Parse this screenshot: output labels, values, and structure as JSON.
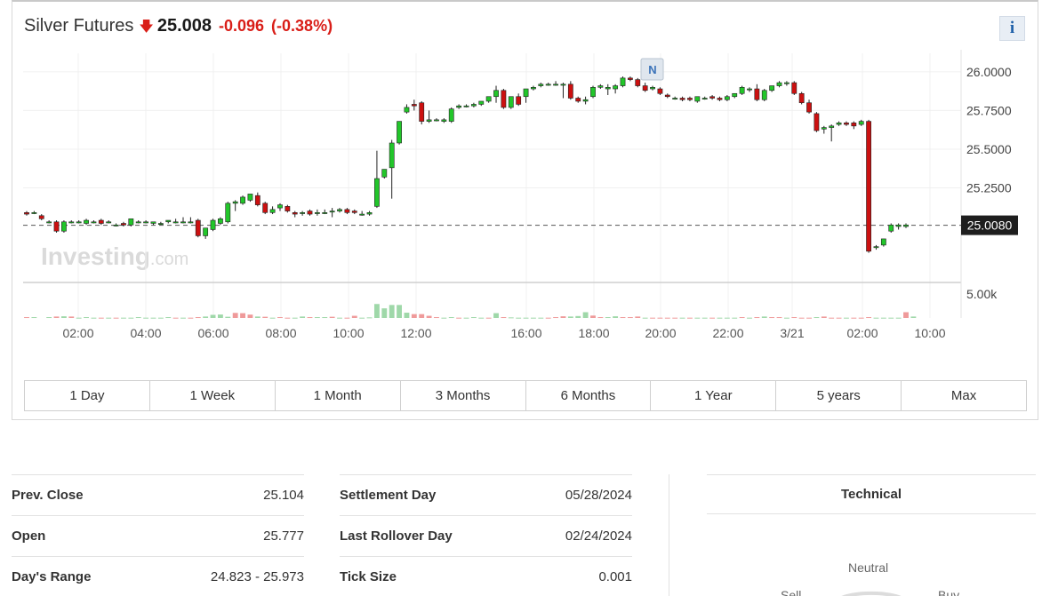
{
  "header": {
    "title": "Silver Futures",
    "direction_icon": "down-arrow-icon",
    "price": "25.008",
    "change": "-0.096",
    "change_pct": "(-0.38%)",
    "info_label": "i"
  },
  "colors": {
    "up": "#22c62a",
    "down": "#cc1010",
    "vol_up": "#9fd8a9",
    "vol_down": "#ef9a9a"
  },
  "chart_data": {
    "type": "candlestick",
    "y_ticks": [
      "26.0000",
      "25.7500",
      "25.5000",
      "25.2500"
    ],
    "ylim": [
      24.73,
      26.12
    ],
    "current_price_label": "25.0080",
    "current_price": 25.008,
    "volume_tick_label": "5.00k",
    "volume_tick_value": 5000,
    "volume_max": 7000,
    "x_ticks": [
      "02:00",
      "04:00",
      "06:00",
      "08:00",
      "10:00",
      "12:00",
      "16:00",
      "18:00",
      "20:00",
      "22:00",
      "3/21",
      "02:00",
      "10:00"
    ],
    "news_marker": "N",
    "watermark": "Investing",
    "watermark_suffix": ".com",
    "candles": [
      [
        25.09,
        25.1,
        25.08,
        25.07
      ],
      [
        25.09,
        25.1,
        25.09,
        25.08
      ],
      [
        25.07,
        25.08,
        25.05,
        25.04
      ],
      [
        25.03,
        25.04,
        25.03,
        25.02
      ],
      [
        25.03,
        25.04,
        24.97,
        24.96
      ],
      [
        24.97,
        25.04,
        25.03,
        24.96
      ],
      [
        25.03,
        25.04,
        25.03,
        25.02
      ],
      [
        25.03,
        25.04,
        25.03,
        25.02
      ],
      [
        25.02,
        25.05,
        25.04,
        25.01
      ],
      [
        25.03,
        25.04,
        25.03,
        25.02
      ],
      [
        25.04,
        25.05,
        25.02,
        25.01
      ],
      [
        25.03,
        25.04,
        25.03,
        25.02
      ],
      [
        25.01,
        25.02,
        25.01,
        25.0
      ],
      [
        25.02,
        25.03,
        25.01,
        25.0
      ],
      [
        25.01,
        25.05,
        25.05,
        25.0
      ],
      [
        25.03,
        25.04,
        25.03,
        25.02
      ],
      [
        25.03,
        25.04,
        25.03,
        25.02
      ],
      [
        25.02,
        25.03,
        25.03,
        25.01
      ],
      [
        25.02,
        25.03,
        25.02,
        25.01
      ],
      [
        25.03,
        25.04,
        25.04,
        25.02
      ],
      [
        25.03,
        25.05,
        25.03,
        25.02
      ],
      [
        25.03,
        25.06,
        25.03,
        25.02
      ],
      [
        25.03,
        25.06,
        25.03,
        25.02
      ],
      [
        25.04,
        25.05,
        24.94,
        24.93
      ],
      [
        24.94,
        24.99,
        24.99,
        24.92
      ],
      [
        24.98,
        25.05,
        25.04,
        24.97
      ],
      [
        25.02,
        25.06,
        25.05,
        25.01
      ],
      [
        25.03,
        25.16,
        25.15,
        25.02
      ],
      [
        25.15,
        25.17,
        25.16,
        25.1
      ],
      [
        25.15,
        25.2,
        25.19,
        25.14
      ],
      [
        25.17,
        25.21,
        25.21,
        25.16
      ],
      [
        25.2,
        25.22,
        25.14,
        25.13
      ],
      [
        25.15,
        25.16,
        25.09,
        25.08
      ],
      [
        25.09,
        25.13,
        25.11,
        25.08
      ],
      [
        25.12,
        25.15,
        25.14,
        25.1
      ],
      [
        25.13,
        25.14,
        25.1,
        25.09
      ],
      [
        25.09,
        25.1,
        25.08,
        25.06
      ],
      [
        25.09,
        25.1,
        25.09,
        25.07
      ],
      [
        25.1,
        25.11,
        25.08,
        25.07
      ],
      [
        25.09,
        25.11,
        25.09,
        25.07
      ],
      [
        25.09,
        25.11,
        25.09,
        25.08
      ],
      [
        25.1,
        25.12,
        25.1,
        25.06
      ],
      [
        25.1,
        25.12,
        25.11,
        25.09
      ],
      [
        25.11,
        25.12,
        25.09,
        25.08
      ],
      [
        25.1,
        25.11,
        25.09,
        25.08
      ],
      [
        25.08,
        25.1,
        25.08,
        25.07
      ],
      [
        25.08,
        25.1,
        25.09,
        25.07
      ],
      [
        25.13,
        25.49,
        25.31,
        25.12
      ],
      [
        25.32,
        25.37,
        25.37,
        25.31
      ],
      [
        25.38,
        25.56,
        25.54,
        25.18
      ],
      [
        25.54,
        25.68,
        25.68,
        25.53
      ],
      [
        25.74,
        25.79,
        25.77,
        25.73
      ],
      [
        25.79,
        25.82,
        25.78,
        25.75
      ],
      [
        25.8,
        25.81,
        25.68,
        25.66
      ],
      [
        25.68,
        25.75,
        25.69,
        25.67
      ],
      [
        25.69,
        25.7,
        25.69,
        25.68
      ],
      [
        25.68,
        25.7,
        25.69,
        25.67
      ],
      [
        25.68,
        25.77,
        25.76,
        25.67
      ],
      [
        25.77,
        25.79,
        25.78,
        25.76
      ],
      [
        25.78,
        25.79,
        25.78,
        25.77
      ],
      [
        25.78,
        25.8,
        25.79,
        25.77
      ],
      [
        25.79,
        25.81,
        25.81,
        25.78
      ],
      [
        25.81,
        25.84,
        25.84,
        25.8
      ],
      [
        25.84,
        25.91,
        25.88,
        25.8
      ],
      [
        25.88,
        25.89,
        25.77,
        25.76
      ],
      [
        25.77,
        25.84,
        25.84,
        25.76
      ],
      [
        25.84,
        25.86,
        25.79,
        25.78
      ],
      [
        25.84,
        25.89,
        25.89,
        25.8
      ],
      [
        25.89,
        25.91,
        25.9,
        25.88
      ],
      [
        25.91,
        25.93,
        25.92,
        25.9
      ],
      [
        25.92,
        25.93,
        25.92,
        25.91
      ],
      [
        25.92,
        25.94,
        25.92,
        25.91
      ],
      [
        25.92,
        25.93,
        25.92,
        25.83
      ],
      [
        25.92,
        25.94,
        25.83,
        25.82
      ],
      [
        25.83,
        25.84,
        25.81,
        25.8
      ],
      [
        25.81,
        25.84,
        25.82,
        25.79
      ],
      [
        25.84,
        25.91,
        25.9,
        25.83
      ],
      [
        25.9,
        25.92,
        25.91,
        25.89
      ],
      [
        25.89,
        25.92,
        25.9,
        25.85
      ],
      [
        25.89,
        25.92,
        25.91,
        25.86
      ],
      [
        25.91,
        25.97,
        25.96,
        25.9
      ],
      [
        25.96,
        25.97,
        25.95,
        25.94
      ],
      [
        25.95,
        25.96,
        25.91,
        25.9
      ],
      [
        25.91,
        25.93,
        25.88,
        25.87
      ],
      [
        25.89,
        25.91,
        25.9,
        25.88
      ],
      [
        25.89,
        25.9,
        25.86,
        25.85
      ],
      [
        25.85,
        25.86,
        25.84,
        25.83
      ],
      [
        25.83,
        25.84,
        25.83,
        25.82
      ],
      [
        25.83,
        25.84,
        25.82,
        25.81
      ],
      [
        25.83,
        25.84,
        25.82,
        25.81
      ],
      [
        25.81,
        25.84,
        25.84,
        25.8
      ],
      [
        25.83,
        25.84,
        25.83,
        25.82
      ],
      [
        25.84,
        25.85,
        25.83,
        25.82
      ],
      [
        25.83,
        25.84,
        25.82,
        25.81
      ],
      [
        25.82,
        25.85,
        25.84,
        25.81
      ],
      [
        25.84,
        25.86,
        25.86,
        25.83
      ],
      [
        25.86,
        25.91,
        25.9,
        25.85
      ],
      [
        25.89,
        25.9,
        25.89,
        25.87
      ],
      [
        25.89,
        25.92,
        25.82,
        25.81
      ],
      [
        25.82,
        25.89,
        25.88,
        25.81
      ],
      [
        25.88,
        25.91,
        25.91,
        25.87
      ],
      [
        25.91,
        25.94,
        25.93,
        25.9
      ],
      [
        25.93,
        25.94,
        25.93,
        25.91
      ],
      [
        25.93,
        25.94,
        25.86,
        25.85
      ],
      [
        25.86,
        25.87,
        25.8,
        25.79
      ],
      [
        25.8,
        25.82,
        25.74,
        25.73
      ],
      [
        25.73,
        25.74,
        25.62,
        25.61
      ],
      [
        25.63,
        25.65,
        25.64,
        25.6
      ],
      [
        25.64,
        25.66,
        25.65,
        25.55
      ],
      [
        25.66,
        25.68,
        25.67,
        25.65
      ],
      [
        25.67,
        25.68,
        25.66,
        25.65
      ],
      [
        25.67,
        25.68,
        25.65,
        25.63
      ],
      [
        25.66,
        25.69,
        25.68,
        25.65
      ],
      [
        25.68,
        25.69,
        24.84,
        24.83
      ],
      [
        24.87,
        24.88,
        24.87,
        24.85
      ],
      [
        24.88,
        24.92,
        24.92,
        24.87
      ],
      [
        24.97,
        25.02,
        25.01,
        24.96
      ],
      [
        25.0,
        25.02,
        25.01,
        24.98
      ],
      [
        25.0,
        25.02,
        25.01,
        24.99
      ]
    ],
    "volume": [
      180,
      180,
      0,
      180,
      300,
      350,
      300,
      60,
      180,
      60,
      60,
      60,
      60,
      60,
      60,
      180,
      60,
      60,
      60,
      180,
      60,
      60,
      60,
      180,
      300,
      650,
      720,
      250,
      1050,
      1000,
      700,
      300,
      250,
      60,
      180,
      60,
      60,
      300,
      180,
      180,
      180,
      250,
      60,
      60,
      450,
      60,
      120,
      2900,
      2000,
      2700,
      2700,
      1100,
      800,
      800,
      450,
      180,
      60,
      180,
      60,
      60,
      180,
      60,
      60,
      1000,
      180,
      120,
      60,
      60,
      60,
      60,
      60,
      180,
      350,
      300,
      400,
      1200,
      500,
      180,
      180,
      350,
      180,
      180,
      300,
      60,
      60,
      60,
      60,
      60,
      60,
      60,
      60,
      60,
      60,
      60,
      60,
      60,
      180,
      60,
      180,
      300,
      180,
      180,
      60,
      180,
      60,
      60,
      180,
      300,
      60,
      60,
      60,
      60,
      60,
      180,
      60,
      60,
      60,
      60,
      1200,
      300
    ],
    "volume_up_flags": [
      0,
      1,
      0,
      1,
      0,
      1,
      0,
      1,
      1,
      1,
      0,
      1,
      0,
      1,
      1,
      1,
      1,
      1,
      1,
      1,
      0,
      1,
      0,
      0,
      1,
      1,
      1,
      1,
      0,
      0,
      0,
      1,
      0,
      1,
      0,
      0,
      1,
      1,
      0,
      1,
      1,
      0,
      1,
      0,
      0,
      1,
      1,
      1,
      1,
      1,
      1,
      1,
      0,
      0,
      0,
      0,
      1,
      1,
      0,
      1,
      1,
      1,
      0,
      1,
      0,
      1,
      1,
      1,
      1,
      1,
      0,
      0,
      0,
      1,
      1,
      1,
      0,
      0,
      1,
      1,
      0,
      0,
      0,
      1,
      0,
      0,
      0,
      0,
      1,
      0,
      1,
      1,
      0,
      1,
      1,
      1,
      0,
      1,
      0,
      1,
      0,
      0,
      1,
      0,
      0,
      0,
      1,
      0,
      0,
      0,
      1,
      0,
      0,
      0,
      1,
      1,
      1,
      1,
      0,
      1
    ]
  },
  "ranges": [
    "1 Day",
    "1 Week",
    "1 Month",
    "3 Months",
    "6 Months",
    "1 Year",
    "5 years",
    "Max"
  ],
  "stats_left": [
    {
      "label": "Prev. Close",
      "value": "25.104"
    },
    {
      "label": "Open",
      "value": "25.777"
    },
    {
      "label": "Day's Range",
      "value": "24.823 - 25.973"
    }
  ],
  "stats_mid": [
    {
      "label": "Settlement Day",
      "value": "05/28/2024"
    },
    {
      "label": "Last Rollover Day",
      "value": "02/24/2024"
    },
    {
      "label": "Tick Size",
      "value": "0.001"
    }
  ],
  "technical": {
    "title": "Technical",
    "neutral_label": "Neutral",
    "sell_label": "Sell",
    "buy_label": "Buy"
  }
}
